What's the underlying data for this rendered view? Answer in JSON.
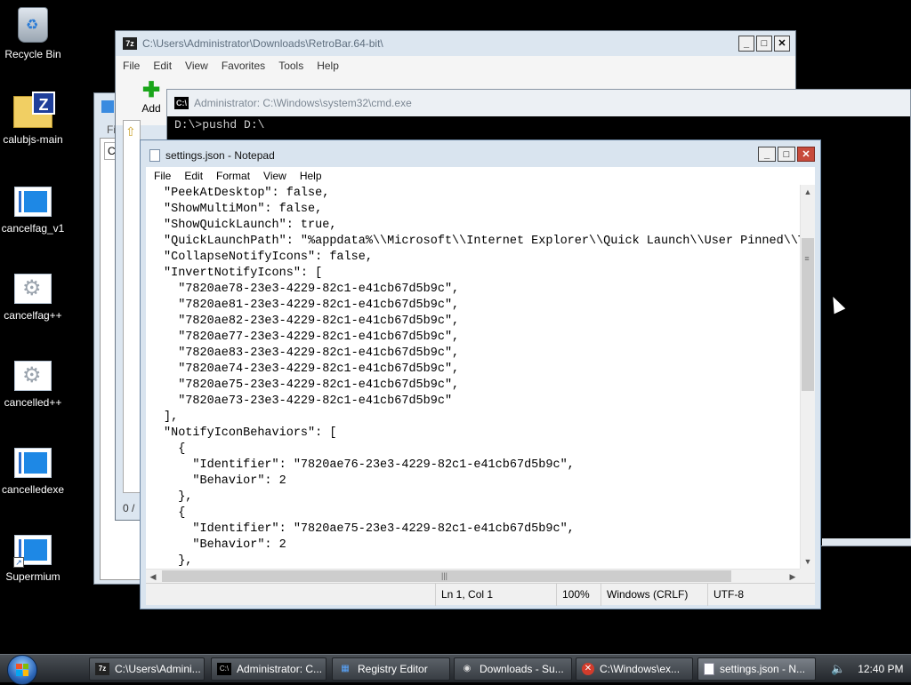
{
  "desktop": {
    "icons": [
      {
        "label": "Recycle Bin"
      },
      {
        "label": "calubjs-main"
      },
      {
        "label": "cancelfag_v1"
      },
      {
        "label": "cancelfag++"
      },
      {
        "label": "cancelled++"
      },
      {
        "label": "cancelledexe"
      },
      {
        "label": "Supermium"
      }
    ]
  },
  "sevenzip": {
    "title": "C:\\Users\\Administrator\\Downloads\\RetroBar.64-bit\\",
    "menu": [
      "File",
      "Edit",
      "View",
      "Favorites",
      "Tools",
      "Help"
    ],
    "toolbar": {
      "add_label": "Add",
      "partial_label": "E"
    },
    "left_fragments": {
      "fi": "Fi",
      "c": "C",
      "na": "Na",
      "status": "0 /"
    }
  },
  "cmd": {
    "title": "Administrator: C:\\Windows\\system32\\cmd.exe",
    "line": "D:\\>pushd D:\\"
  },
  "notepad": {
    "title": "settings.json - Notepad",
    "menu": [
      "File",
      "Edit",
      "Format",
      "View",
      "Help"
    ],
    "content_lines": [
      "\"PeekAtDesktop\": false,",
      "\"ShowMultiMon\": false,",
      "\"ShowQuickLaunch\": true,",
      "\"QuickLaunchPath\": \"%appdata%\\\\Microsoft\\\\Internet Explorer\\\\Quick Launch\\\\User Pinned\\\\T",
      "\"CollapseNotifyIcons\": false,",
      "\"InvertNotifyIcons\": [",
      "  \"7820ae78-23e3-4229-82c1-e41cb67d5b9c\",",
      "  \"7820ae81-23e3-4229-82c1-e41cb67d5b9c\",",
      "  \"7820ae82-23e3-4229-82c1-e41cb67d5b9c\",",
      "  \"7820ae77-23e3-4229-82c1-e41cb67d5b9c\",",
      "  \"7820ae83-23e3-4229-82c1-e41cb67d5b9c\",",
      "  \"7820ae74-23e3-4229-82c1-e41cb67d5b9c\",",
      "  \"7820ae75-23e3-4229-82c1-e41cb67d5b9c\",",
      "  \"7820ae73-23e3-4229-82c1-e41cb67d5b9c\"",
      "],",
      "\"NotifyIconBehaviors\": [",
      "  {",
      "    \"Identifier\": \"7820ae76-23e3-4229-82c1-e41cb67d5b9c\",",
      "    \"Behavior\": 2",
      "  },",
      "  {",
      "    \"Identifier\": \"7820ae75-23e3-4229-82c1-e41cb67d5b9c\",",
      "    \"Behavior\": 2",
      "  },"
    ],
    "status": {
      "position": "Ln 1, Col 1",
      "zoom": "100%",
      "line_ending": "Windows (CRLF)",
      "encoding": "UTF-8"
    }
  },
  "taskbar": {
    "buttons": [
      {
        "label": "C:\\Users\\Admini...",
        "icon": "7zip-icon"
      },
      {
        "label": "Administrator: C...",
        "icon": "cmd-icon"
      },
      {
        "label": "Registry Editor",
        "icon": "registry-icon"
      },
      {
        "label": "Downloads - Su...",
        "icon": "browser-icon"
      },
      {
        "label": "C:\\Windows\\ex...",
        "icon": "error-icon"
      },
      {
        "label": "settings.json - N...",
        "icon": "notepad-icon"
      }
    ],
    "clock": "12:40 PM"
  }
}
